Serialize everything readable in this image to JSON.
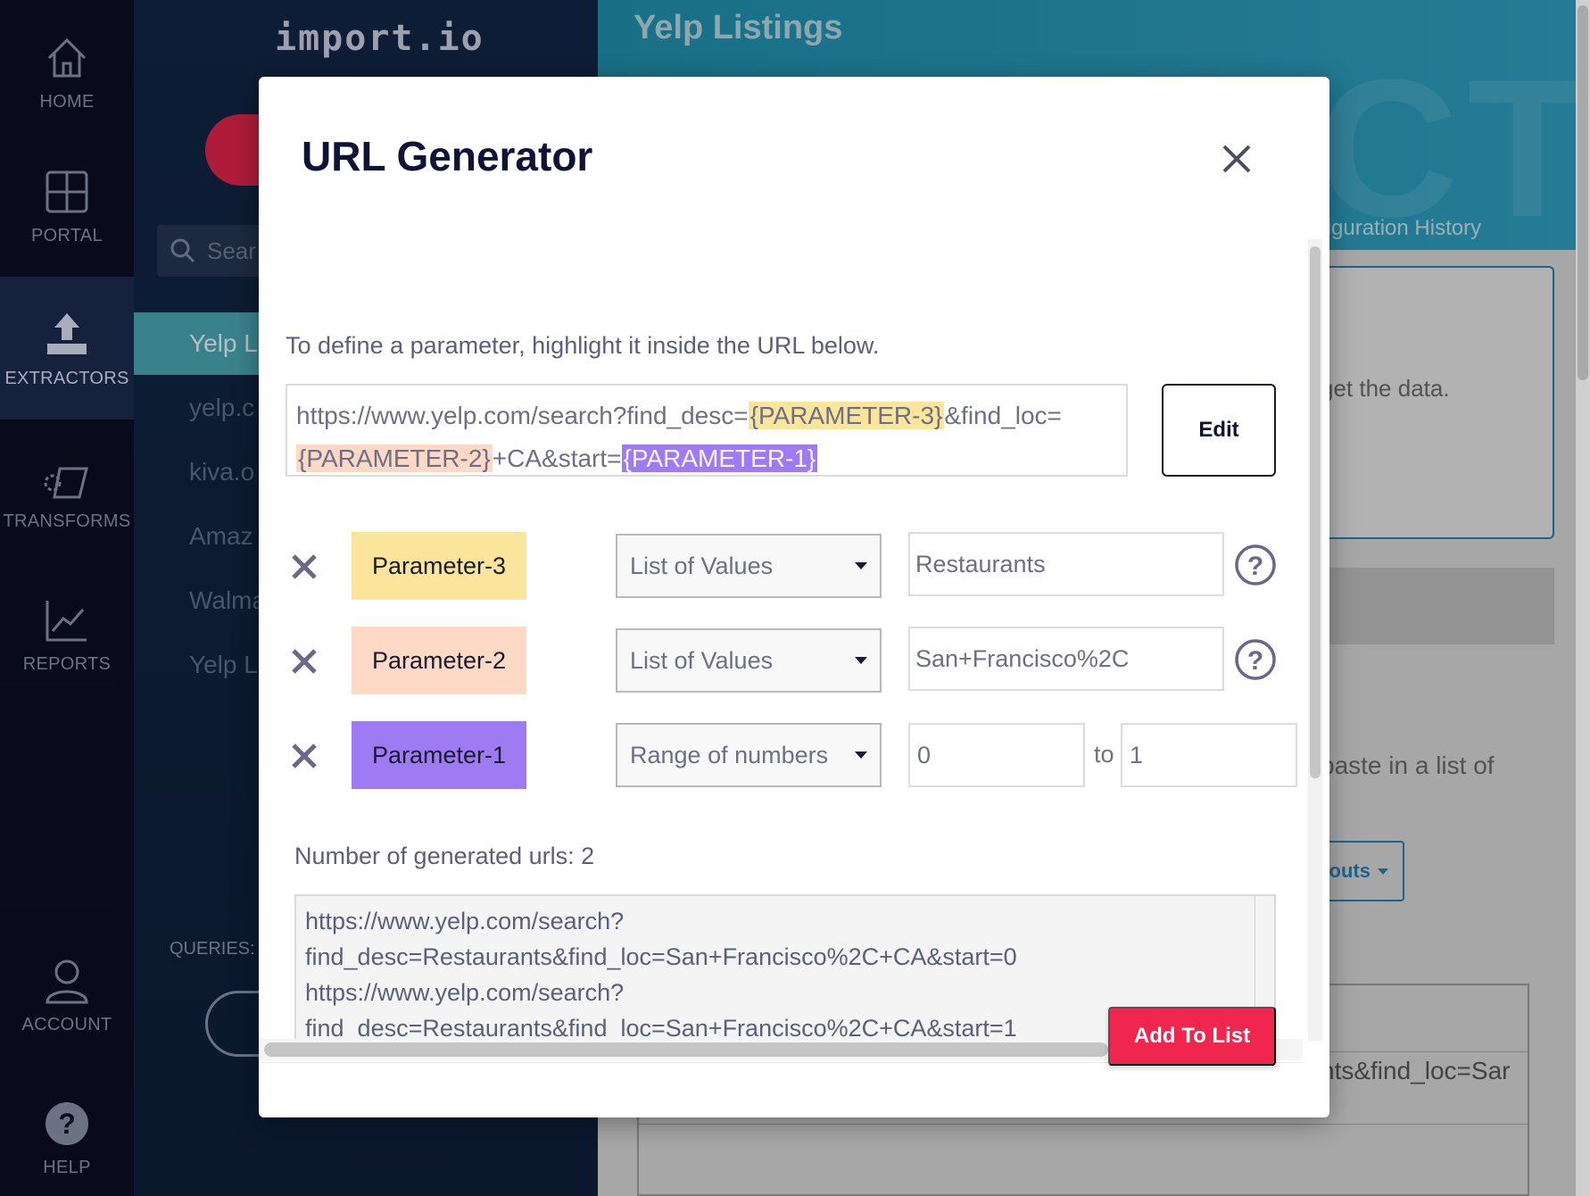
{
  "nav": {
    "items": [
      {
        "label": "HOME",
        "icon": "home-icon"
      },
      {
        "label": "PORTAL",
        "icon": "grid-icon"
      },
      {
        "label": "EXTRACTORS",
        "icon": "upload-icon",
        "active": true
      },
      {
        "label": "TRANSFORMS",
        "icon": "transform-icon"
      },
      {
        "label": "REPORTS",
        "icon": "chart-icon"
      },
      {
        "label": "ACCOUNT",
        "icon": "user-icon"
      },
      {
        "label": "HELP",
        "icon": "help-icon"
      }
    ]
  },
  "panel": {
    "brand": "import.io",
    "search_placeholder": "Sear",
    "items": [
      "Yelp L",
      "yelp.c",
      "kiva.o",
      "Amaz",
      "Walma",
      "Yelp L"
    ],
    "queries_label": "QUERIES:"
  },
  "background": {
    "title": "Yelp Listings",
    "watermark": "EXTRACTOR",
    "config_history": "figuration History",
    "card_text": "get the data.",
    "paste_text": "paste in a list of",
    "inputs_btn": "outs",
    "table_text": "nts&find_loc=Sar"
  },
  "modal": {
    "title": "URL Generator",
    "instruction": "To define a parameter, highlight it inside the URL below.",
    "url": {
      "part1": "https://www.yelp.com/search?find_desc=",
      "param3": "{PARAMETER-3}",
      "part2": "&find_loc=",
      "param2": "{PARAMETER-2}",
      "part3": "+CA&start=",
      "param1": "{PARAMETER-1}"
    },
    "edit_label": "Edit",
    "params": [
      {
        "name": "Parameter-3",
        "type": "List of Values",
        "value": "Restaurants",
        "color": "#fbe59b"
      },
      {
        "name": "Parameter-2",
        "type": "List of Values",
        "value": "San+Francisco%2C",
        "color": "#fdd9c6"
      },
      {
        "name": "Parameter-1",
        "type": "Range of numbers",
        "from": "0",
        "to_label": "to",
        "to": "1",
        "color": "#9e7af3"
      }
    ],
    "generated_count": "Number of generated urls: 2",
    "generated_lines": [
      "https://www.yelp.com/search?",
      "find_desc=Restaurants&find_loc=San+Francisco%2C+CA&start=0",
      "https://www.yelp.com/search?",
      "find_desc=Restaurants&find_loc=San+Francisco%2C+CA&start=1"
    ],
    "add_label": "Add To List"
  },
  "colors": {
    "accent_red": "#f0264e",
    "nav_bg": "#0d0f22",
    "panel_bg": "#112645",
    "header_teal": "#2f9fc0"
  }
}
